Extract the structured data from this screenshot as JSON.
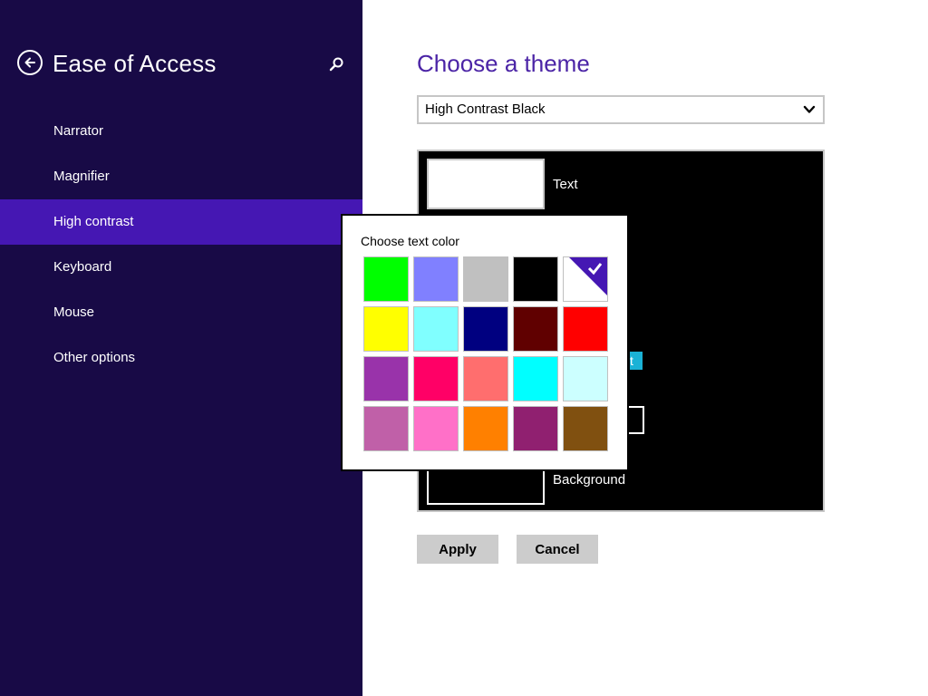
{
  "sidebar": {
    "title": "Ease of Access",
    "items": [
      {
        "label": "Narrator"
      },
      {
        "label": "Magnifier"
      },
      {
        "label": "High contrast",
        "selected": true
      },
      {
        "label": "Keyboard"
      },
      {
        "label": "Mouse"
      },
      {
        "label": "Other options"
      }
    ]
  },
  "main": {
    "title": "Choose a theme",
    "theme_select": {
      "value": "High Contrast Black"
    },
    "preview": {
      "text_label": "Text",
      "text_fragment": "t",
      "background_label": "Background",
      "text_color": "#ffffff",
      "background_color": "#000000"
    },
    "apply_label": "Apply",
    "cancel_label": "Cancel"
  },
  "color_picker": {
    "title": "Choose text color",
    "selected_index": 4,
    "colors": [
      "#00ff00",
      "#8080ff",
      "#c0c0c0",
      "#000000",
      "#ffffff",
      "#ffff00",
      "#80ffff",
      "#000080",
      "#600000",
      "#ff0000",
      "#9933aa",
      "#ff0066",
      "#ff6e6e",
      "#00ffff",
      "#ccffff",
      "#c060a8",
      "#ff70c8",
      "#ff8000",
      "#902070",
      "#805010"
    ]
  },
  "colors": {
    "sidebar_bg": "#180a46",
    "nav_selected_bg": "#4517b3",
    "accent": "#4b24a6"
  },
  "icons": {
    "back": "back-arrow-icon",
    "search": "search-icon",
    "chevron": "chevron-down-icon",
    "check": "checkmark-icon"
  }
}
